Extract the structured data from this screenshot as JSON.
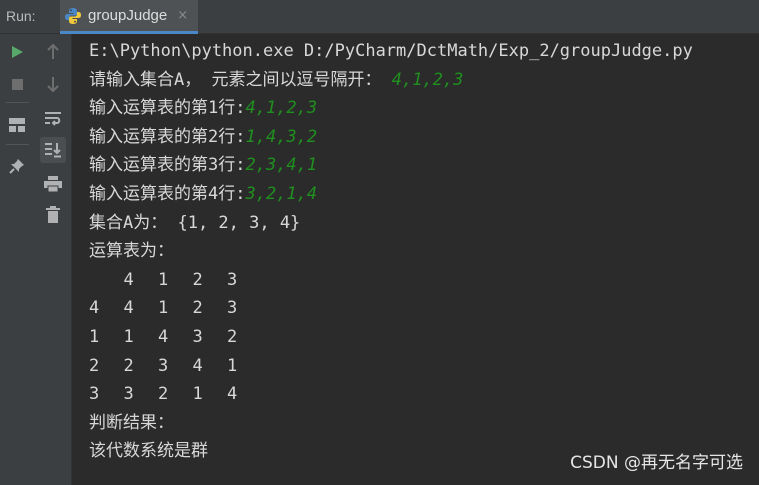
{
  "header": {
    "run_label": "Run:",
    "tab_title": "groupJudge",
    "tab_close": "×"
  },
  "icons": {
    "tab": "python-icon",
    "left_toolbar": [
      "run-icon",
      "stop-icon",
      "layout-icon",
      "pin-icon"
    ],
    "right_toolbar": [
      "arrow-up-icon",
      "arrow-down-icon",
      "soft-wrap-icon",
      "scroll-to-end-icon",
      "print-icon",
      "trash-icon"
    ]
  },
  "colors": {
    "background": "#2b2b2b",
    "toolbar": "#3c3f41",
    "text": "#d8d8d8",
    "user_input": "#1f8f1f",
    "run_green": "#59a869",
    "accent": "#4a88c7"
  },
  "console": {
    "command": "E:\\Python\\python.exe D:/PyCharm/DctMath/Exp_2/groupJudge.py",
    "prompt_set": "请输入集合A， 元素之间以逗号隔开： ",
    "input_set": "4,1,2,3",
    "row_prompts": [
      {
        "prompt": "输入运算表的第1行:",
        "input": "4,1,2,3"
      },
      {
        "prompt": "输入运算表的第2行:",
        "input": "1,4,3,2"
      },
      {
        "prompt": "输入运算表的第3行:",
        "input": "2,3,4,1"
      },
      {
        "prompt": "输入运算表的第4行:",
        "input": "3,2,1,4"
      }
    ],
    "set_result": "集合A为： {1, 2, 3, 4}",
    "table_title": "运算表为：",
    "table": [
      [
        "",
        "4",
        "1",
        "2",
        "3"
      ],
      [
        "4",
        "4",
        "1",
        "2",
        "3"
      ],
      [
        "1",
        "1",
        "4",
        "3",
        "2"
      ],
      [
        "2",
        "2",
        "3",
        "4",
        "1"
      ],
      [
        "3",
        "3",
        "2",
        "1",
        "4"
      ]
    ],
    "judge_title": "判断结果：",
    "judge_result": "该代数系统是群"
  },
  "watermark": "CSDN @再无名字可选"
}
